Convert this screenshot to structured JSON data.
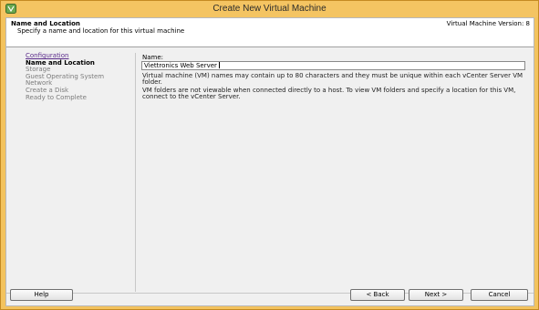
{
  "window": {
    "title": "Create New Virtual Machine"
  },
  "header": {
    "title": "Name and Location",
    "subtitle": "Specify a name and location for this virtual machine",
    "version": "Virtual Machine Version: 8"
  },
  "nav": {
    "items": [
      {
        "label": "Configuration",
        "state": "link"
      },
      {
        "label": "Name and Location",
        "state": "active"
      },
      {
        "label": "Storage",
        "state": "inactive"
      },
      {
        "label": "Guest Operating System",
        "state": "inactive"
      },
      {
        "label": "Network",
        "state": "inactive"
      },
      {
        "label": "Create a Disk",
        "state": "inactive"
      },
      {
        "label": "Ready to Complete",
        "state": "inactive"
      }
    ]
  },
  "form": {
    "name_label": "Name:",
    "name_value": "Viettronics Web Server",
    "desc1": "Virtual machine (VM) names may contain up to 80 characters and they must be unique within each vCenter Server VM folder.",
    "desc2": "VM folders are not viewable when connected directly to a host. To view VM folders and specify a location for this VM, connect to the vCenter Server."
  },
  "buttons": {
    "help": "Help",
    "back": "< Back",
    "next": "Next >",
    "cancel": "Cancel"
  },
  "colors": {
    "titlebar": "#f4c462",
    "link": "#5a2a8a",
    "inactive_nav": "#7b7b7b"
  }
}
